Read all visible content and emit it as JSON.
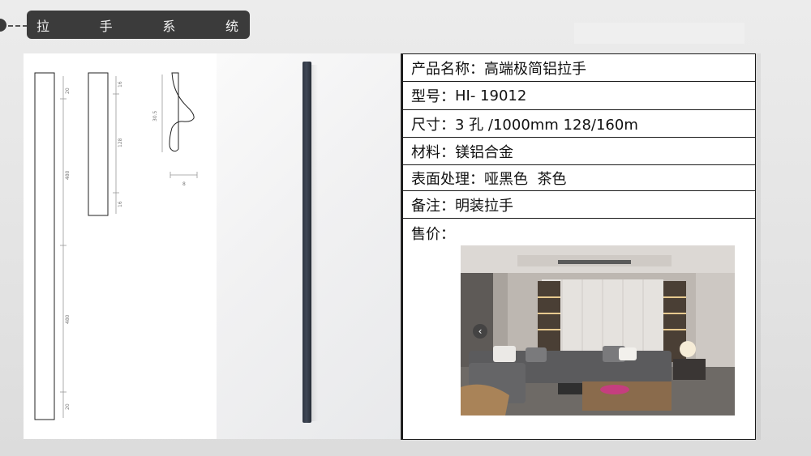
{
  "header": {
    "chars": [
      "拉",
      "手",
      "系",
      "统"
    ]
  },
  "drawing": {
    "front_dims": [
      "20",
      "480",
      "480",
      "20"
    ],
    "side_dims": [
      "16",
      "128",
      "16"
    ],
    "profile_height": "30.5",
    "profile_width": "8"
  },
  "spec": {
    "rows": [
      {
        "label": "产品名称：",
        "value": "高端极简铝拉手"
      },
      {
        "label": "型号：",
        "value": "HI- 19012"
      },
      {
        "label": "尺寸：",
        "value": "3 孔 /1000mm 128/160m"
      },
      {
        "label": "材料：",
        "value": "镁铝合金"
      },
      {
        "label": "表面处理：",
        "value": "哑黑色  茶色"
      },
      {
        "label": "备注：",
        "value": "明装拉手"
      },
      {
        "label": "售价：",
        "value": ""
      }
    ]
  },
  "carousel": {
    "prev_icon": "‹"
  },
  "colors": {
    "header_bg": "#3b3b3b",
    "handle": "#343b47",
    "border": "#1a1a1a"
  }
}
